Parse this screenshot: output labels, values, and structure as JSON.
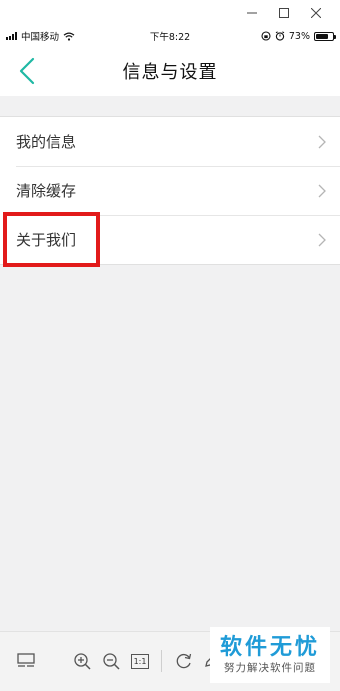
{
  "status_bar": {
    "carrier": "中国移动",
    "time": "下午8:22",
    "battery_text": "73%",
    "battery_level": 0.73
  },
  "header": {
    "title": "信息与设置"
  },
  "menu": {
    "items": [
      {
        "label": "我的信息"
      },
      {
        "label": "清除缓存"
      },
      {
        "label": "关于我们"
      }
    ]
  },
  "viewer_toolbar": {
    "ratio_label": "1:1"
  },
  "watermark": {
    "title": "软件无忧",
    "subtitle": "努力解决软件问题"
  },
  "colors": {
    "accent": "#1fb8a4",
    "highlight": "#e21a1a",
    "watermark": "#1f9bd7"
  }
}
